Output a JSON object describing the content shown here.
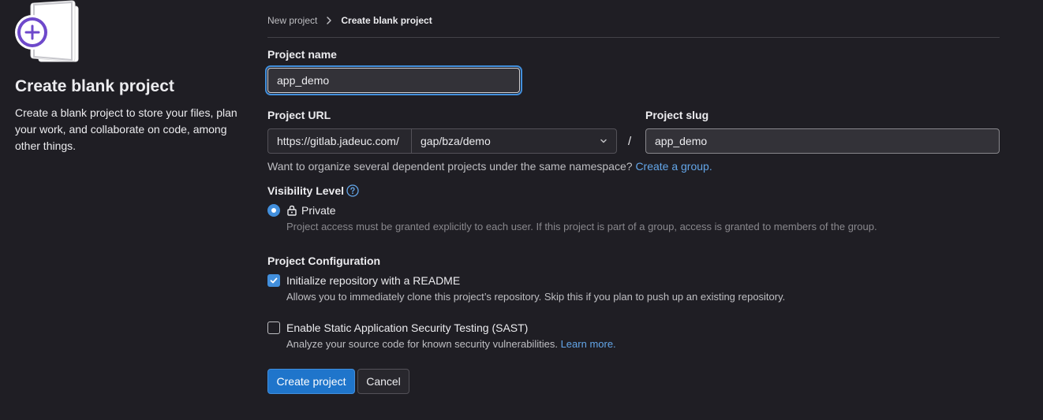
{
  "left": {
    "title": "Create blank project",
    "description": "Create a blank project to store your files, plan your work, and collaborate on code, among other things."
  },
  "breadcrumb": {
    "parent": "New project",
    "current": "Create blank project"
  },
  "project_name": {
    "label": "Project name",
    "value": "app_demo"
  },
  "project_url": {
    "label": "Project URL",
    "prefix": "https://gitlab.jadeuc.com/",
    "namespace": "gap/bza/demo",
    "separator": "/"
  },
  "project_slug": {
    "label": "Project slug",
    "value": "app_demo"
  },
  "namespace_hint": {
    "text": "Want to organize several dependent projects under the same namespace?",
    "link": "Create a group."
  },
  "visibility": {
    "label": "Visibility Level",
    "option_label": "Private",
    "option_help": "Project access must be granted explicitly to each user. If this project is part of a group, access is granted to members of the group."
  },
  "configuration": {
    "label": "Project Configuration",
    "readme": {
      "label": "Initialize repository with a README",
      "help": "Allows you to immediately clone this project’s repository. Skip this if you plan to push up an existing repository."
    },
    "sast": {
      "label": "Enable Static Application Security Testing (SAST)",
      "help": "Analyze your source code for known security vulnerabilities.",
      "link": "Learn more."
    }
  },
  "buttons": {
    "create": "Create project",
    "cancel": "Cancel"
  },
  "colors": {
    "background": "#1f1e24",
    "accent": "#428fdc",
    "primary_button": "#1f75cb",
    "link": "#63a6e9",
    "illustration_purple": "#6e49cb"
  }
}
